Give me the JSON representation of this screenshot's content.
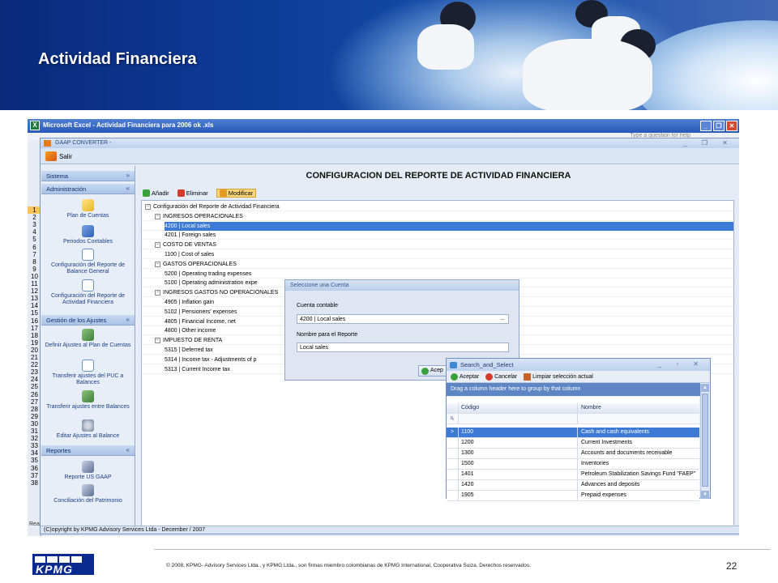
{
  "slide": {
    "title": "Actividad Financiera",
    "page_number": "22",
    "copyright": "© 2008, KPMG- Advisory Services Ltda., y KPMG Ltda., son firmas miembro colombianas de KPMG International, Cooperativa Suiza. Derechos reservados.",
    "logo_text": "KPMG"
  },
  "excel": {
    "title": "Microsoft Excel - Actividad Financiera para 2006 ok .xls",
    "menu_hint": "Type a question for help",
    "row_numbers": [
      "1",
      "2",
      "3",
      "4",
      "5",
      "6",
      "7",
      "8",
      "9",
      "10",
      "11",
      "12",
      "13",
      "14",
      "15",
      "16",
      "17",
      "18",
      "19",
      "20",
      "21",
      "22",
      "23",
      "24",
      "25",
      "26",
      "27",
      "28",
      "29",
      "30",
      "31",
      "32",
      "33",
      "34",
      "35",
      "36",
      "37",
      "38"
    ],
    "selected_row": "1",
    "status": "Rea"
  },
  "gaap": {
    "title": "GAAP CONVERTER -",
    "salir": "Salir",
    "status": "(C)opyright by KPMG Advisory Services Ltda - December / 2007"
  },
  "left_panel": {
    "sistema": "Sistema",
    "administracion": "Administración",
    "admin_items": [
      {
        "label": "Plan de Cuentas",
        "icon": "folder-icon"
      },
      {
        "label": "Periodos Contables",
        "icon": "book-icon"
      },
      {
        "label": "Configuración del Reporte de Balance General",
        "icon": "document-icon"
      },
      {
        "label": "Configuración del Reporte de Actividad Financiera",
        "icon": "document-icon"
      }
    ],
    "gestion": "Gestión de los Ajustes",
    "gestion_items": [
      {
        "label": "Definir Ajustes al Plan de Cuentas",
        "icon": "gear-icon"
      },
      {
        "label": "Transferir ajustes del PUC a Balances",
        "icon": "document-icon"
      },
      {
        "label": "Transferir ajustes entre Balances",
        "icon": "gear-icon"
      },
      {
        "label": "Editar Ajustes al Balance",
        "icon": "disk-icon"
      }
    ],
    "reportes": "Reportes",
    "reportes_items": [
      {
        "label": "Reporte US GAAP",
        "icon": "printer-icon"
      },
      {
        "label": "Conciliación del Patrimonio",
        "icon": "printer-icon"
      }
    ]
  },
  "main": {
    "title": "CONFIGURACION DEL REPORTE DE ACTIVIDAD FINANCIERA",
    "toolbar": {
      "add": "Añadir",
      "delete": "Eliminar",
      "modify": "Modificar"
    },
    "tree": [
      {
        "text": "Configuración del Reporte de Actividad Financiera",
        "level": 0,
        "expander": "−"
      },
      {
        "text": "INGRESOS OPERACIONALES",
        "level": 1,
        "expander": "−"
      },
      {
        "text": "4200 | Local sales",
        "level": 2,
        "selected": true
      },
      {
        "text": "4201 | Foreign sales",
        "level": 2
      },
      {
        "text": "COSTO DE VENTAS",
        "level": 1,
        "expander": "−"
      },
      {
        "text": "1100 | Cost of sales",
        "level": 2
      },
      {
        "text": "GASTOS OPERACIONALES",
        "level": 1,
        "expander": "−"
      },
      {
        "text": "5200 | Operating trading expenses",
        "level": 2
      },
      {
        "text": "5100 | Operating administration expe",
        "level": 2
      },
      {
        "text": "INGRESOS GASTOS NO OPERACIONALES",
        "level": 1,
        "expander": "−"
      },
      {
        "text": "4905 | Inflation gain",
        "level": 2
      },
      {
        "text": "5102 | Pensioners' expenses",
        "level": 2
      },
      {
        "text": "4805 | Financial Income, net",
        "level": 2
      },
      {
        "text": "4800 | Other income",
        "level": 2
      },
      {
        "text": "IMPUESTO DE RENTA",
        "level": 1,
        "expander": "−"
      },
      {
        "text": "5315 | Deferred tax",
        "level": 2
      },
      {
        "text": "5314 | Income tax - Adjustments of p",
        "level": 2
      },
      {
        "text": "5313 | Current Income tax",
        "level": 2
      }
    ]
  },
  "dialog": {
    "title": "Seleccione una Cuenta",
    "cuenta_label": "Cuenta contable",
    "cuenta_value": "4200 | Local sales",
    "cuenta_ellipsis": "...",
    "nombre_label": "Nombre para el Reporte",
    "nombre_value": "Local sales",
    "ok": "Acep"
  },
  "search": {
    "title": "Search_and_Select",
    "accept": "Aceptar",
    "cancel": "Cancelar",
    "clear": "Limpiar selección actual",
    "group_hint": "Drag a column header here to group by that column",
    "col_code": "Código",
    "col_name": "Nombre",
    "filter_icon": "ꝶ",
    "row_indicator": ">",
    "rows": [
      {
        "code": "1100",
        "name": "Cash and cash equivalents",
        "selected": true
      },
      {
        "code": "1200",
        "name": "Current Investments"
      },
      {
        "code": "1300",
        "name": "Accounts and documents receivable"
      },
      {
        "code": "1500",
        "name": "Inventories"
      },
      {
        "code": "1401",
        "name": "Petroleum Stabilization Savings Fund \"FAEP\""
      },
      {
        "code": "1420",
        "name": "Advances and deposits"
      },
      {
        "code": "1905",
        "name": "Prepaid expenses"
      }
    ]
  }
}
